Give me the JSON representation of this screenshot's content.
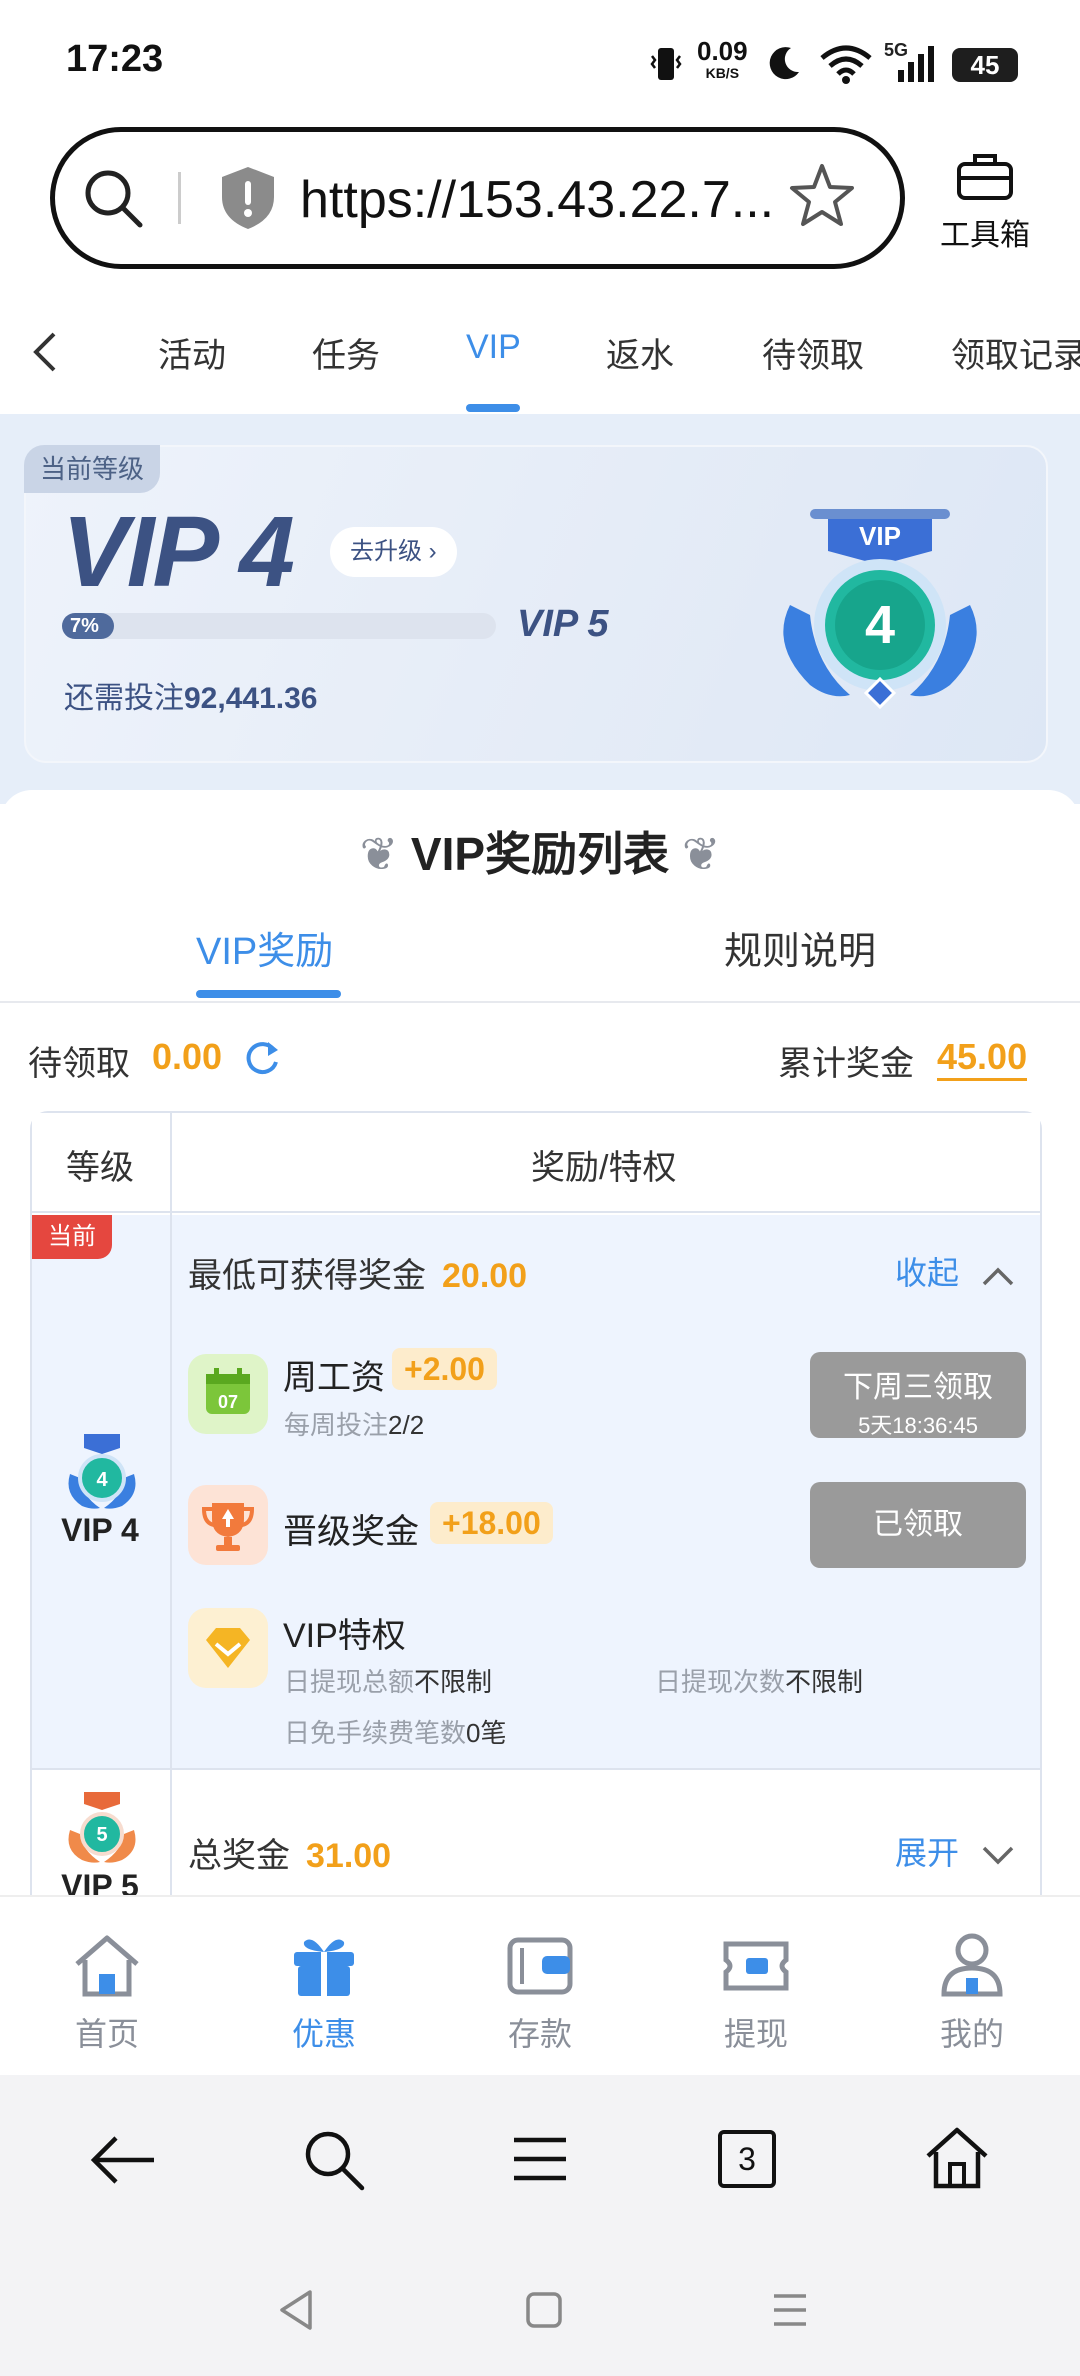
{
  "status_bar": {
    "time": "17:23",
    "net_speed": "0.09",
    "net_unit": "KB/S",
    "network": "5G",
    "battery": "45"
  },
  "browser": {
    "url": "https://153.43.22.7...",
    "toolbox_label": "工具箱"
  },
  "tabs": [
    {
      "label": "活动"
    },
    {
      "label": "任务"
    },
    {
      "label": "VIP",
      "active": true
    },
    {
      "label": "返水"
    },
    {
      "label": "待领取"
    },
    {
      "label": "领取记录"
    }
  ],
  "vip_card": {
    "tag": "当前等级",
    "level": "VIP 4",
    "upgrade_label": "去升级",
    "progress_label": "7%",
    "progress_fraction": 0.07,
    "next_level": "VIP 5",
    "need_bet_label": "还需投注",
    "need_bet_value": "92,441.36",
    "badge_vip": "VIP",
    "badge_number": "4"
  },
  "rewards": {
    "title": "VIP奖励列表",
    "sub_tabs": [
      {
        "label": "VIP奖励",
        "active": true
      },
      {
        "label": "规则说明"
      }
    ],
    "pending_label": "待领取",
    "pending_value": "0.00",
    "total_label": "累计奖金",
    "total_value": "45.00",
    "table": {
      "col_level": "等级",
      "col_reward": "奖励/特权",
      "current_tag": "当前",
      "vip4": {
        "level_label": "VIP 4",
        "badge_number": "4",
        "min_bonus_label": "最低可获得奖金",
        "min_bonus_value": "20.00",
        "collapse_label": "收起",
        "weekly": {
          "title": "周工资",
          "amount": "+2.00",
          "sub_label": "每周投注",
          "sub_value": "2/2",
          "icon_day": "07",
          "button_line1": "下周三领取",
          "button_line2": "5天18:36:45"
        },
        "promotion": {
          "title": "晋级奖金",
          "amount": "+18.00",
          "button": "已领取"
        },
        "privilege": {
          "title": "VIP特权",
          "items": [
            {
              "label": "日提现总额",
              "value": "不限制"
            },
            {
              "label": "日提现次数",
              "value": "不限制"
            },
            {
              "label": "日免手续费笔数",
              "value": "0笔"
            }
          ]
        }
      },
      "vip5": {
        "level_label": "VIP 5",
        "badge_number": "5",
        "total_label": "总奖金",
        "total_value": "31.00",
        "expand_label": "展开"
      }
    }
  },
  "app_nav": [
    {
      "label": "首页",
      "icon": "home-icon"
    },
    {
      "label": "优惠",
      "icon": "gift-icon",
      "active": true
    },
    {
      "label": "存款",
      "icon": "wallet-icon"
    },
    {
      "label": "提现",
      "icon": "withdraw-icon"
    },
    {
      "label": "我的",
      "icon": "user-icon"
    }
  ],
  "browser_bar": {
    "tabs_count": "3"
  },
  "colors": {
    "accent": "#3d8ee8",
    "amount": "#f2a01a",
    "vip_navy": "#3c5283",
    "current_tag": "#e5473f"
  }
}
